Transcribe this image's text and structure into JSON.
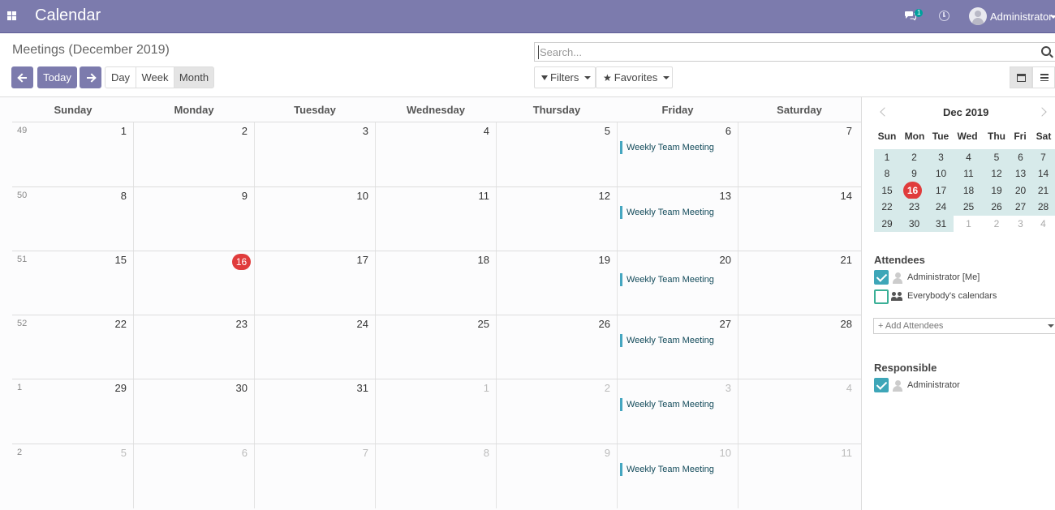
{
  "navbar": {
    "apps_icon": "grid-icon",
    "app_title": "Calendar",
    "chat_badge": "1",
    "user_name": "Administrator"
  },
  "control_panel": {
    "breadcrumb": "Meetings (December 2019)",
    "today_label": "Today",
    "views": [
      "Day",
      "Week",
      "Month"
    ],
    "active_view": "Month",
    "search_placeholder": "Search...",
    "filters_label": "Filters",
    "favorites_label": "Favorites"
  },
  "calendar": {
    "weekday_headers": [
      "Sunday",
      "Monday",
      "Tuesday",
      "Wednesday",
      "Thursday",
      "Friday",
      "Saturday"
    ],
    "weeks": [
      {
        "num": "49",
        "days": [
          "1",
          "2",
          "3",
          "4",
          "5",
          "6",
          "7"
        ],
        "other": [
          false,
          false,
          false,
          false,
          false,
          false,
          false
        ]
      },
      {
        "num": "50",
        "days": [
          "8",
          "9",
          "10",
          "11",
          "12",
          "13",
          "14"
        ],
        "other": [
          false,
          false,
          false,
          false,
          false,
          false,
          false
        ]
      },
      {
        "num": "51",
        "days": [
          "15",
          "16",
          "17",
          "18",
          "19",
          "20",
          "21"
        ],
        "other": [
          false,
          false,
          false,
          false,
          false,
          false,
          false
        ]
      },
      {
        "num": "52",
        "days": [
          "22",
          "23",
          "24",
          "25",
          "26",
          "27",
          "28"
        ],
        "other": [
          false,
          false,
          false,
          false,
          false,
          false,
          false
        ]
      },
      {
        "num": "1",
        "days": [
          "29",
          "30",
          "31",
          "1",
          "2",
          "3",
          "4"
        ],
        "other": [
          false,
          false,
          false,
          true,
          true,
          true,
          true
        ]
      },
      {
        "num": "2",
        "days": [
          "5",
          "6",
          "7",
          "8",
          "9",
          "10",
          "11"
        ],
        "other": [
          true,
          true,
          true,
          true,
          true,
          true,
          true
        ]
      }
    ],
    "today": "16",
    "event_title": "Weekly Team Meeting",
    "event_weekday": "Friday",
    "accent_color": "#45a6c0",
    "today_color": "#e03c3c",
    "brand_color": "#7c7bad"
  },
  "sidebar": {
    "mini_title": "Dec 2019",
    "mini_dow": [
      "Sun",
      "Mon",
      "Tue",
      "Wed",
      "Thu",
      "Fri",
      "Sat"
    ],
    "mini_weeks": [
      [
        "1",
        "2",
        "3",
        "4",
        "5",
        "6",
        "7"
      ],
      [
        "8",
        "9",
        "10",
        "11",
        "12",
        "13",
        "14"
      ],
      [
        "15",
        "16",
        "17",
        "18",
        "19",
        "20",
        "21"
      ],
      [
        "22",
        "23",
        "24",
        "25",
        "26",
        "27",
        "28"
      ],
      [
        "29",
        "30",
        "31",
        "1",
        "2",
        "3",
        "4"
      ]
    ],
    "attendees_title": "Attendees",
    "attendees": [
      {
        "label": "Administrator [Me]",
        "checked": true,
        "icon": "user-icon"
      },
      {
        "label": "Everybody's calendars",
        "checked": false,
        "icon": "users-icon"
      }
    ],
    "add_attendees_placeholder": "+ Add Attendees",
    "responsible_title": "Responsible",
    "responsible": [
      {
        "label": "Administrator",
        "checked": true,
        "icon": "user-icon"
      }
    ]
  }
}
